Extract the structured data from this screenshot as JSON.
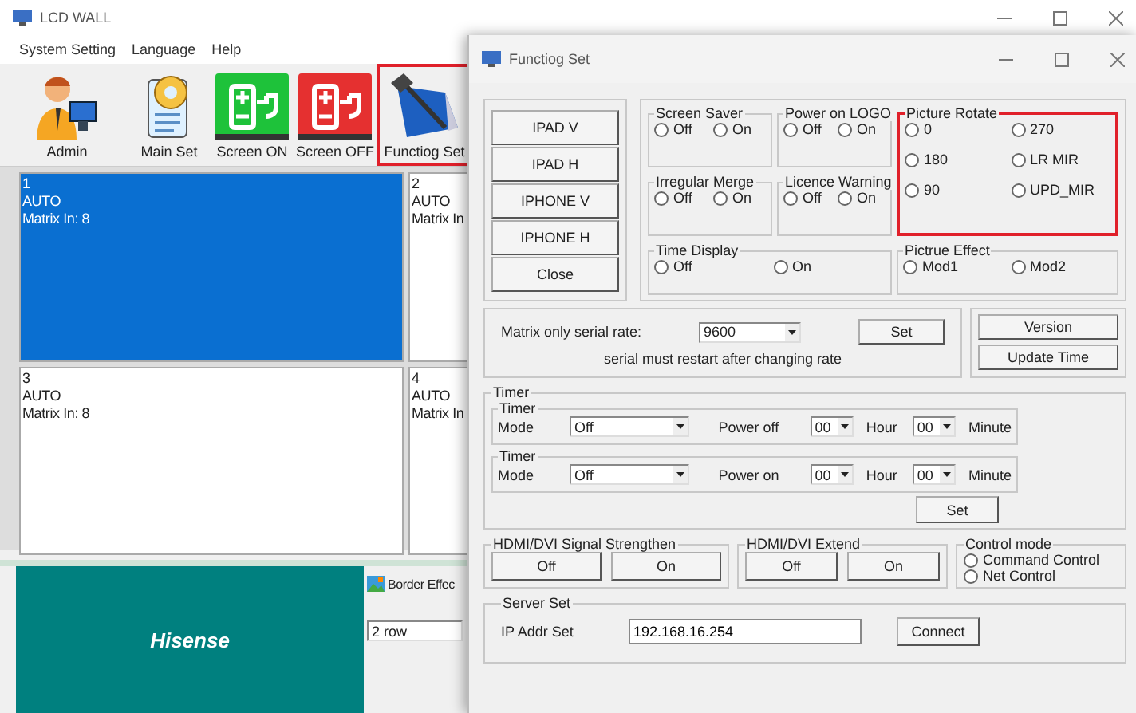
{
  "main_window": {
    "title": "LCD WALL",
    "menu": [
      "System Setting",
      "Language",
      "Help"
    ],
    "toolbar": [
      {
        "label": "Admin",
        "kind": "admin",
        "highlighted": false
      },
      {
        "label": "Main Set",
        "kind": "settings",
        "highlighted": false
      },
      {
        "label": "Screen ON",
        "kind": "power_on",
        "highlighted": false
      },
      {
        "label": "Screen OFF",
        "kind": "power_off",
        "highlighted": false
      },
      {
        "label": "Functiog Set",
        "kind": "tools",
        "highlighted": true
      }
    ],
    "screens": [
      {
        "number": "1",
        "mode": "AUTO",
        "input": "Matrix In: 8",
        "selected": true
      },
      {
        "number": "2",
        "mode": "AUTO",
        "input": "Matrix In",
        "selected": false
      },
      {
        "number": "3",
        "mode": "AUTO",
        "input": "Matrix In: 8",
        "selected": false
      },
      {
        "number": "4",
        "mode": "AUTO",
        "input": "Matrix In",
        "selected": false
      }
    ],
    "brand": "Hisense",
    "border_effect": {
      "title": "Border Effec",
      "rows": "2 row"
    }
  },
  "dialog": {
    "title": "Functiog Set",
    "device_buttons": [
      "IPAD V",
      "IPAD H",
      "IPHONE V",
      "IPHONE H",
      "Close"
    ],
    "toggle_groups": [
      {
        "title": "Screen Saver",
        "options": [
          {
            "label": "Off",
            "selected": false
          },
          {
            "label": "On",
            "selected": false
          }
        ]
      },
      {
        "title": "Power on LOGO",
        "options": [
          {
            "label": "Off",
            "selected": false
          },
          {
            "label": "On",
            "selected": false
          }
        ]
      },
      {
        "title": "Irregular Merge",
        "options": [
          {
            "label": "Off",
            "selected": false
          },
          {
            "label": "On",
            "selected": false
          }
        ]
      },
      {
        "title": "Licence Warning",
        "options": [
          {
            "label": "Off",
            "selected": false
          },
          {
            "label": "On",
            "selected": false
          }
        ]
      }
    ],
    "time_display": {
      "title": "Time Display",
      "options": [
        {
          "label": "Off",
          "selected": false
        },
        {
          "label": "On",
          "selected": false
        }
      ]
    },
    "picture_rotate": {
      "title": "Picture Rotate",
      "highlighted": true,
      "options": [
        {
          "label": "0",
          "selected": false
        },
        {
          "label": "270",
          "selected": false
        },
        {
          "label": "180",
          "selected": false
        },
        {
          "label": "LR MIR",
          "selected": false
        },
        {
          "label": "90",
          "selected": false
        },
        {
          "label": "UPD_MIR",
          "selected": false
        }
      ]
    },
    "picture_effect": {
      "title": "Pictrue Effect",
      "options": [
        {
          "label": "Mod1",
          "selected": false
        },
        {
          "label": "Mod2",
          "selected": false
        }
      ]
    },
    "serial": {
      "label": "Matrix only serial rate:",
      "value": "9600",
      "button": "Set",
      "note": "serial must restart after changing rate"
    },
    "info_buttons": [
      "Version",
      "Update Time"
    ],
    "timer": {
      "title": "Timer",
      "rows": [
        {
          "title": "Timer",
          "mode_label": "Mode",
          "mode": "Off",
          "action": "Power off",
          "hour": "00",
          "hour_label": "Hour",
          "minute": "00",
          "minute_label": "Minute"
        },
        {
          "title": "Timer",
          "mode_label": "Mode",
          "mode": "Off",
          "action": "Power on",
          "hour": "00",
          "hour_label": "Hour",
          "minute": "00",
          "minute_label": "Minute"
        }
      ],
      "button": "Set"
    },
    "signal_strengthen": {
      "title": "HDMI/DVI Signal Strengthen",
      "buttons": [
        "Off",
        "On"
      ]
    },
    "extend": {
      "title": "HDMI/DVI Extend",
      "buttons": [
        "Off",
        "On"
      ]
    },
    "control_mode": {
      "title": "Control mode",
      "options": [
        {
          "label": "Command Control",
          "selected": false
        },
        {
          "label": "Net Control",
          "selected": false
        }
      ]
    },
    "server": {
      "title": "Server Set",
      "label": "IP Addr Set",
      "ip": "192.168.16.254",
      "button": "Connect"
    }
  }
}
